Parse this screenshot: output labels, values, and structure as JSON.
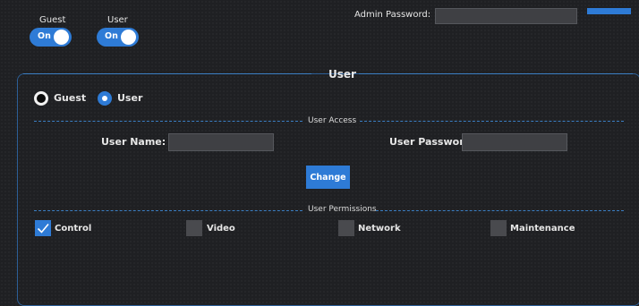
{
  "top": {
    "guest_label": "Guest",
    "user_label": "User",
    "guest_toggle_text": "On",
    "user_toggle_text": "On",
    "admin_password_label": "Admin Password:"
  },
  "panel": {
    "title": "User",
    "radio_guest_label": "Guest",
    "radio_user_label": "User",
    "selected_mode": "User",
    "access": {
      "title": "User Access",
      "user_name_label": "User Name:",
      "user_password_label": "User Password:",
      "user_name_value": "",
      "user_password_value": "",
      "change_button": "Change"
    },
    "permissions": {
      "title": "User Permissions",
      "items": [
        {
          "label": "Control",
          "checked": true
        },
        {
          "label": "Video",
          "checked": false
        },
        {
          "label": "Network",
          "checked": false
        },
        {
          "label": "Maintenance",
          "checked": false
        }
      ]
    }
  },
  "colors": {
    "accent": "#2e7bd6",
    "background": "#1f2023",
    "field": "#3f4044",
    "border": "#2c5f97"
  },
  "icons": [
    "checkmark-icon"
  ]
}
